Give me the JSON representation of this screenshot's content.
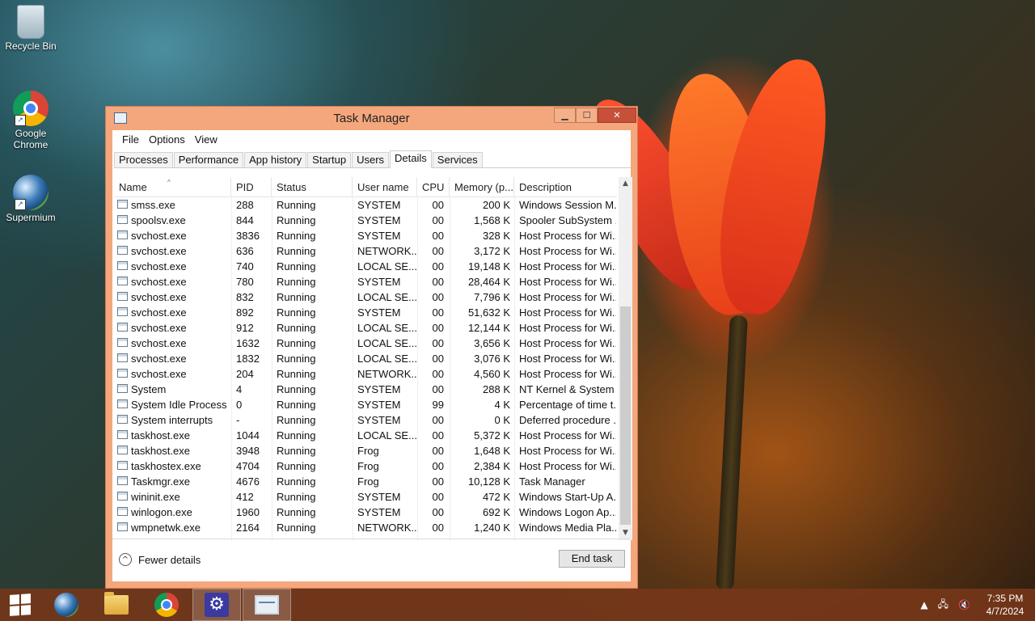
{
  "desktop": {
    "icons": [
      {
        "label": "Recycle Bin"
      },
      {
        "label": "Google Chrome"
      },
      {
        "label": "Supermium"
      }
    ]
  },
  "window": {
    "title": "Task Manager",
    "controls": {
      "minimize": "▁",
      "maximize": "☐",
      "close": "✕"
    },
    "menu": [
      "File",
      "Options",
      "View"
    ],
    "tabs": [
      "Processes",
      "Performance",
      "App history",
      "Startup",
      "Users",
      "Details",
      "Services"
    ],
    "active_tab": "Details",
    "columns": [
      "Name",
      "PID",
      "Status",
      "User name",
      "CPU",
      "Memory (p...",
      "Description"
    ],
    "rows": [
      {
        "name": "smss.exe",
        "pid": "288",
        "status": "Running",
        "user": "SYSTEM",
        "cpu": "00",
        "mem": "200 K",
        "desc": "Windows Session M..."
      },
      {
        "name": "spoolsv.exe",
        "pid": "844",
        "status": "Running",
        "user": "SYSTEM",
        "cpu": "00",
        "mem": "1,568 K",
        "desc": "Spooler SubSystem ..."
      },
      {
        "name": "svchost.exe",
        "pid": "3836",
        "status": "Running",
        "user": "SYSTEM",
        "cpu": "00",
        "mem": "328 K",
        "desc": "Host Process for Wi..."
      },
      {
        "name": "svchost.exe",
        "pid": "636",
        "status": "Running",
        "user": "NETWORK...",
        "cpu": "00",
        "mem": "3,172 K",
        "desc": "Host Process for Wi..."
      },
      {
        "name": "svchost.exe",
        "pid": "740",
        "status": "Running",
        "user": "LOCAL SE...",
        "cpu": "00",
        "mem": "19,148 K",
        "desc": "Host Process for Wi..."
      },
      {
        "name": "svchost.exe",
        "pid": "780",
        "status": "Running",
        "user": "SYSTEM",
        "cpu": "00",
        "mem": "28,464 K",
        "desc": "Host Process for Wi..."
      },
      {
        "name": "svchost.exe",
        "pid": "832",
        "status": "Running",
        "user": "LOCAL SE...",
        "cpu": "00",
        "mem": "7,796 K",
        "desc": "Host Process for Wi..."
      },
      {
        "name": "svchost.exe",
        "pid": "892",
        "status": "Running",
        "user": "SYSTEM",
        "cpu": "00",
        "mem": "51,632 K",
        "desc": "Host Process for Wi..."
      },
      {
        "name": "svchost.exe",
        "pid": "912",
        "status": "Running",
        "user": "LOCAL SE...",
        "cpu": "00",
        "mem": "12,144 K",
        "desc": "Host Process for Wi..."
      },
      {
        "name": "svchost.exe",
        "pid": "1632",
        "status": "Running",
        "user": "LOCAL SE...",
        "cpu": "00",
        "mem": "3,656 K",
        "desc": "Host Process for Wi..."
      },
      {
        "name": "svchost.exe",
        "pid": "1832",
        "status": "Running",
        "user": "LOCAL SE...",
        "cpu": "00",
        "mem": "3,076 K",
        "desc": "Host Process for Wi..."
      },
      {
        "name": "svchost.exe",
        "pid": "204",
        "status": "Running",
        "user": "NETWORK...",
        "cpu": "00",
        "mem": "4,560 K",
        "desc": "Host Process for Wi..."
      },
      {
        "name": "System",
        "pid": "4",
        "status": "Running",
        "user": "SYSTEM",
        "cpu": "00",
        "mem": "288 K",
        "desc": "NT Kernel & System"
      },
      {
        "name": "System Idle Process",
        "pid": "0",
        "status": "Running",
        "user": "SYSTEM",
        "cpu": "99",
        "mem": "4 K",
        "desc": "Percentage of time t..."
      },
      {
        "name": "System interrupts",
        "pid": "-",
        "status": "Running",
        "user": "SYSTEM",
        "cpu": "00",
        "mem": "0 K",
        "desc": "Deferred procedure ..."
      },
      {
        "name": "taskhost.exe",
        "pid": "1044",
        "status": "Running",
        "user": "LOCAL SE...",
        "cpu": "00",
        "mem": "5,372 K",
        "desc": "Host Process for Wi..."
      },
      {
        "name": "taskhost.exe",
        "pid": "3948",
        "status": "Running",
        "user": "Frog",
        "cpu": "00",
        "mem": "1,648 K",
        "desc": "Host Process for Wi..."
      },
      {
        "name": "taskhostex.exe",
        "pid": "4704",
        "status": "Running",
        "user": "Frog",
        "cpu": "00",
        "mem": "2,384 K",
        "desc": "Host Process for Wi..."
      },
      {
        "name": "Taskmgr.exe",
        "pid": "4676",
        "status": "Running",
        "user": "Frog",
        "cpu": "00",
        "mem": "10,128 K",
        "desc": "Task Manager"
      },
      {
        "name": "wininit.exe",
        "pid": "412",
        "status": "Running",
        "user": "SYSTEM",
        "cpu": "00",
        "mem": "472 K",
        "desc": "Windows Start-Up A..."
      },
      {
        "name": "winlogon.exe",
        "pid": "1960",
        "status": "Running",
        "user": "SYSTEM",
        "cpu": "00",
        "mem": "692 K",
        "desc": "Windows Logon Ap..."
      },
      {
        "name": "wmpnetwk.exe",
        "pid": "2164",
        "status": "Running",
        "user": "NETWORK...",
        "cpu": "00",
        "mem": "1,240 K",
        "desc": "Windows Media Pla..."
      }
    ],
    "footer": {
      "fewer_details": "Fewer details",
      "end_task": "End task"
    }
  },
  "taskbar": {
    "clock_time": "7:35 PM",
    "clock_date": "4/7/2024",
    "accent": "#7a3a1c"
  }
}
